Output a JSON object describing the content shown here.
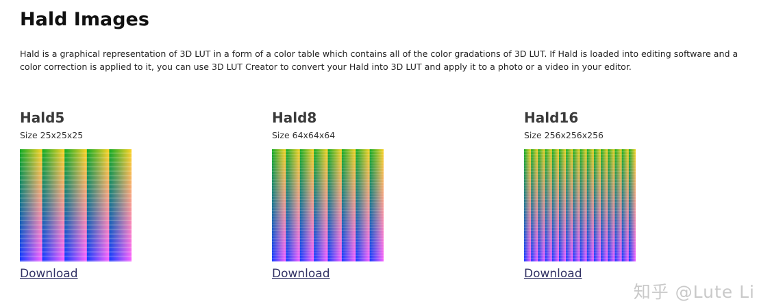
{
  "page": {
    "title": "Hald Images",
    "intro": "Hald is a graphical representation of 3D LUT in a form of a color table which contains all of the color gradations of 3D LUT. If Hald is loaded into editing software and a color correction is applied to it, you can use 3D LUT Creator to convert your Hald into 3D LUT and apply it to a photo or a video in your editor."
  },
  "halds": [
    {
      "title": "Hald5",
      "size_label": "Size 25x25x25",
      "download_label": "Download",
      "columns": 5,
      "rows_per_column": 25
    },
    {
      "title": "Hald8",
      "size_label": "Size 64x64x64",
      "download_label": "Download",
      "columns": 8,
      "rows_per_column": 64
    },
    {
      "title": "Hald16",
      "size_label": "Size 256x256x256",
      "download_label": "Download",
      "columns": 16,
      "rows_per_column": 256
    }
  ],
  "watermark": "知乎 @Lute Li",
  "colors": {
    "link": "#333366",
    "title": "#111111",
    "watermark": "#c9c9c9"
  }
}
